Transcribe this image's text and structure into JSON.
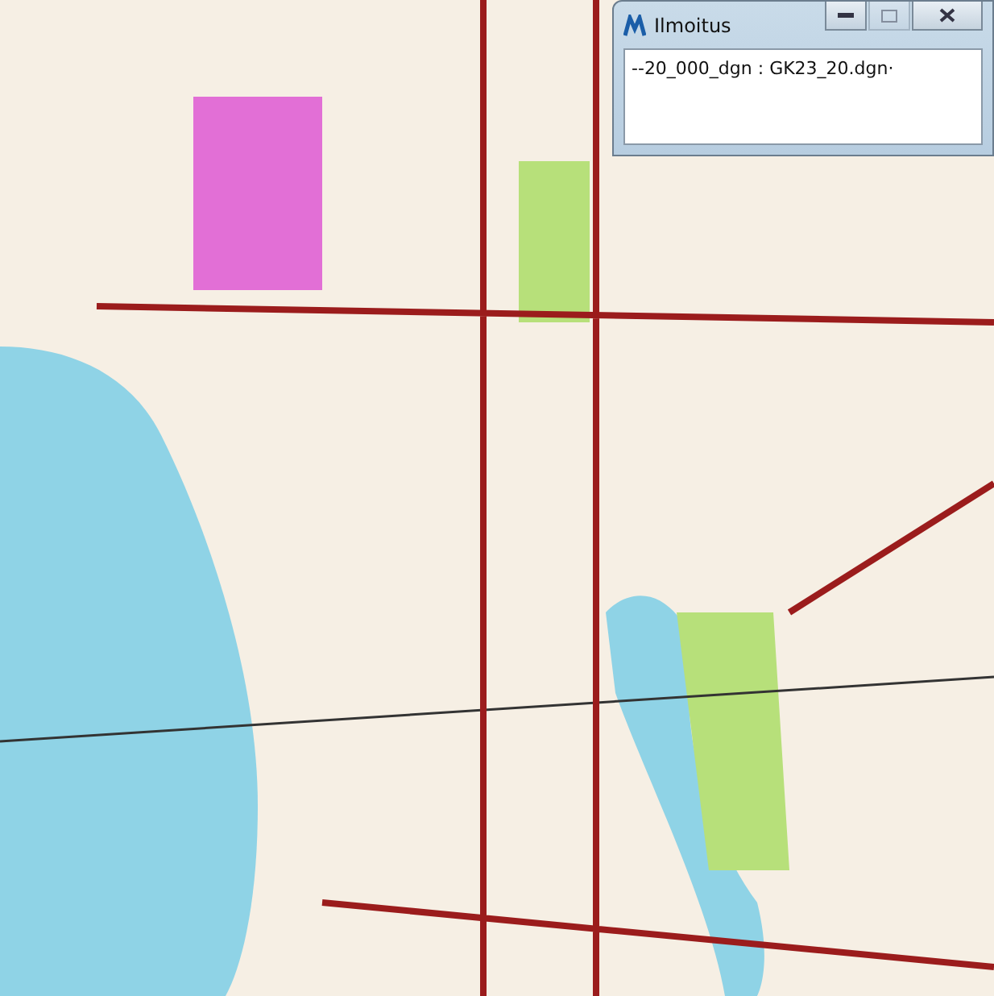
{
  "window": {
    "title": "Ilmoitus",
    "title_buttons": [
      {
        "kind": "minimize",
        "disabled": false
      },
      {
        "kind": "maximize",
        "disabled": true
      },
      {
        "kind": "close",
        "disabled": false
      }
    ],
    "message": "--20_000_dgn : GK23_20.dgn·"
  }
}
